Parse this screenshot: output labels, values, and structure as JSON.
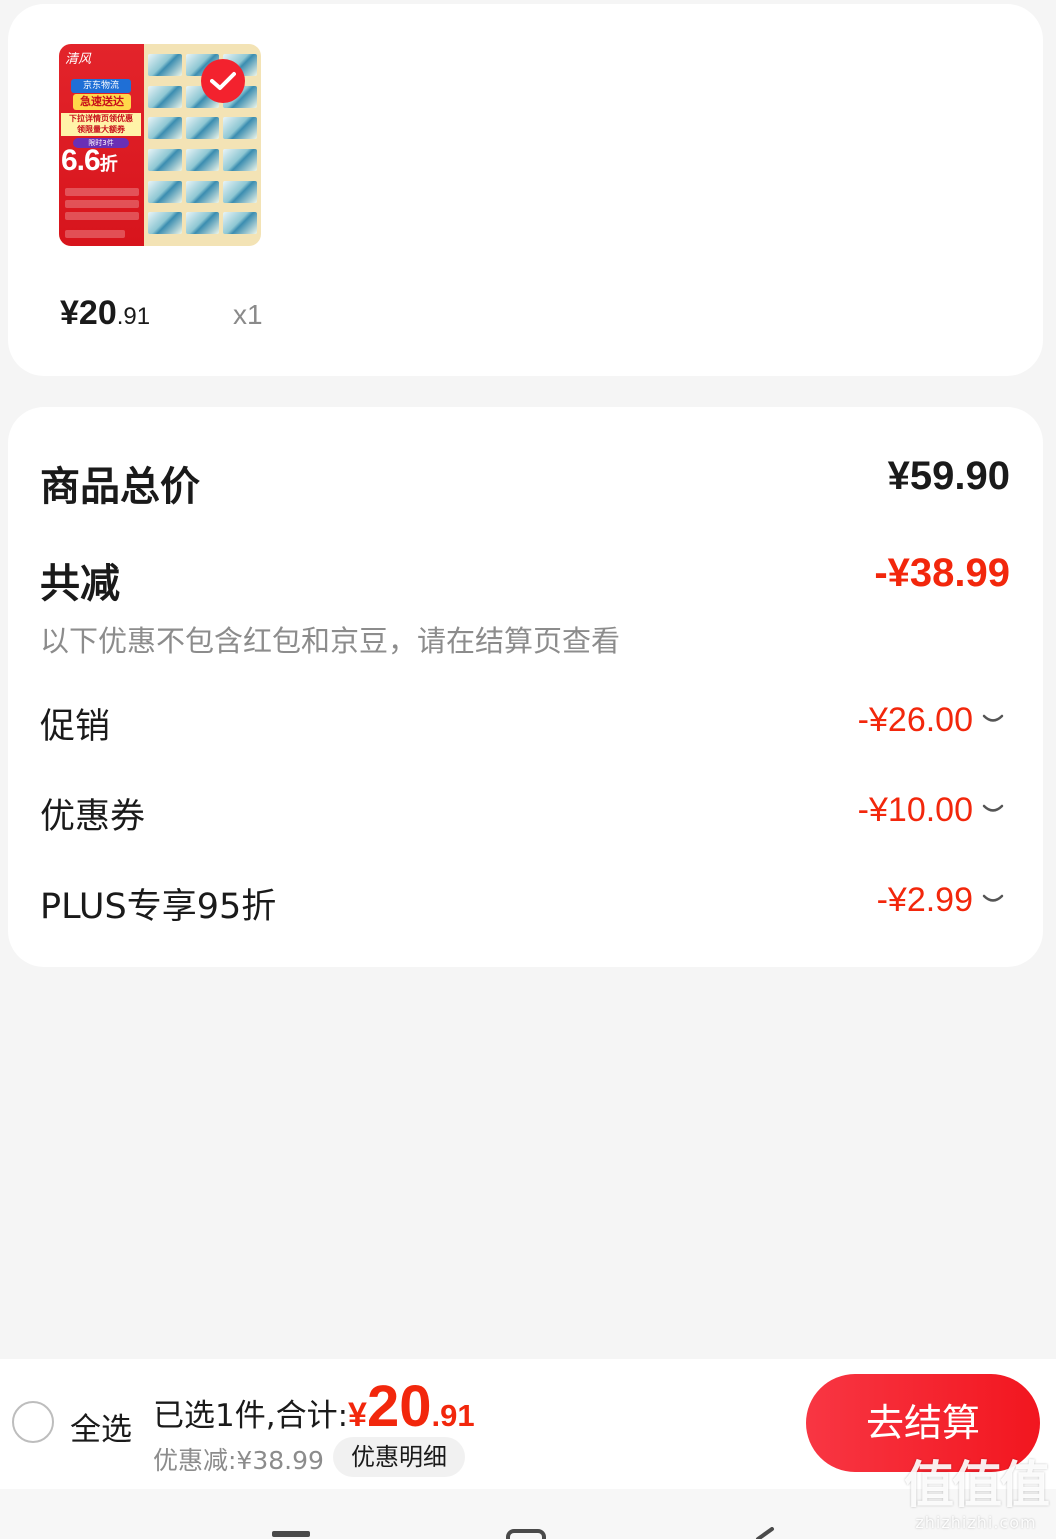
{
  "product": {
    "thumbnail": {
      "brand": "清风",
      "jd_tag": "京东物流",
      "speed": "急速送达",
      "promo_1": "下拉详情页领优惠",
      "promo_2": "领限量大额券",
      "limit": "限时3件",
      "discount_int": "6.6",
      "discount_unit": "折"
    },
    "selected": true,
    "price": {
      "yen": "¥",
      "int": "20",
      "dec": ".91"
    },
    "quantity": "x1"
  },
  "summary": {
    "total_label": "商品总价",
    "total_value": "¥59.90",
    "reduce_label": "共减",
    "reduce_value": "-¥38.99",
    "note": "以下优惠不包含红包和京豆，请在结算页查看",
    "items": [
      {
        "label": "促销",
        "value": "-¥26.00"
      },
      {
        "label": "优惠券",
        "value": "-¥10.00"
      },
      {
        "label": "PLUS专享95折",
        "value": "-¥2.99"
      }
    ]
  },
  "bottom_bar": {
    "select_all": "全选",
    "selected_prefix": "已选1件,合计:",
    "total_yen": "¥",
    "total_int": "20",
    "total_dec": ".91",
    "saved": "优惠减:¥38.99",
    "detail_button": "优惠明细",
    "checkout_button": "去结算"
  },
  "watermark": {
    "big": "值值值",
    "small": "zhizhizhi.com"
  },
  "colors": {
    "accent_red": "#f2270c",
    "button_red": "#f2161f",
    "background": "#f5f5f5"
  }
}
